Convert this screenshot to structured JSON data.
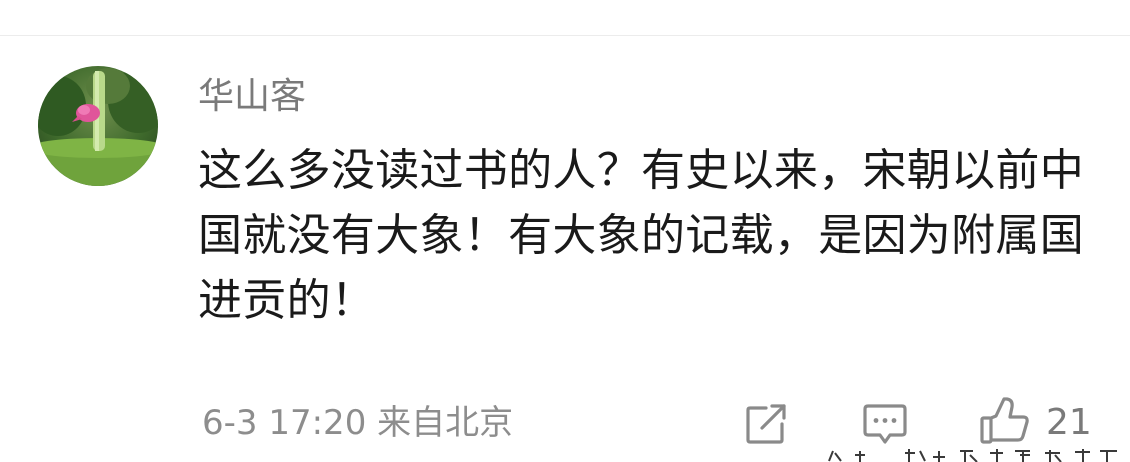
{
  "comment": {
    "username": "华山客",
    "text": "这么多没读过书的人？有史以来，宋朝以前中国就没有大象！有大象的记载，是因为附属国进贡的！",
    "date_time": "6-3 17:20",
    "location": "来自北京",
    "like_count": "21"
  },
  "icons": {
    "share": "share-icon",
    "comment": "comment-icon",
    "like": "thumbs-up-icon"
  },
  "colors": {
    "username": "#7a7a7a",
    "body_text": "#1a1a1a",
    "meta_text": "#8d8d8d",
    "icon": "#8a8a8a"
  }
}
